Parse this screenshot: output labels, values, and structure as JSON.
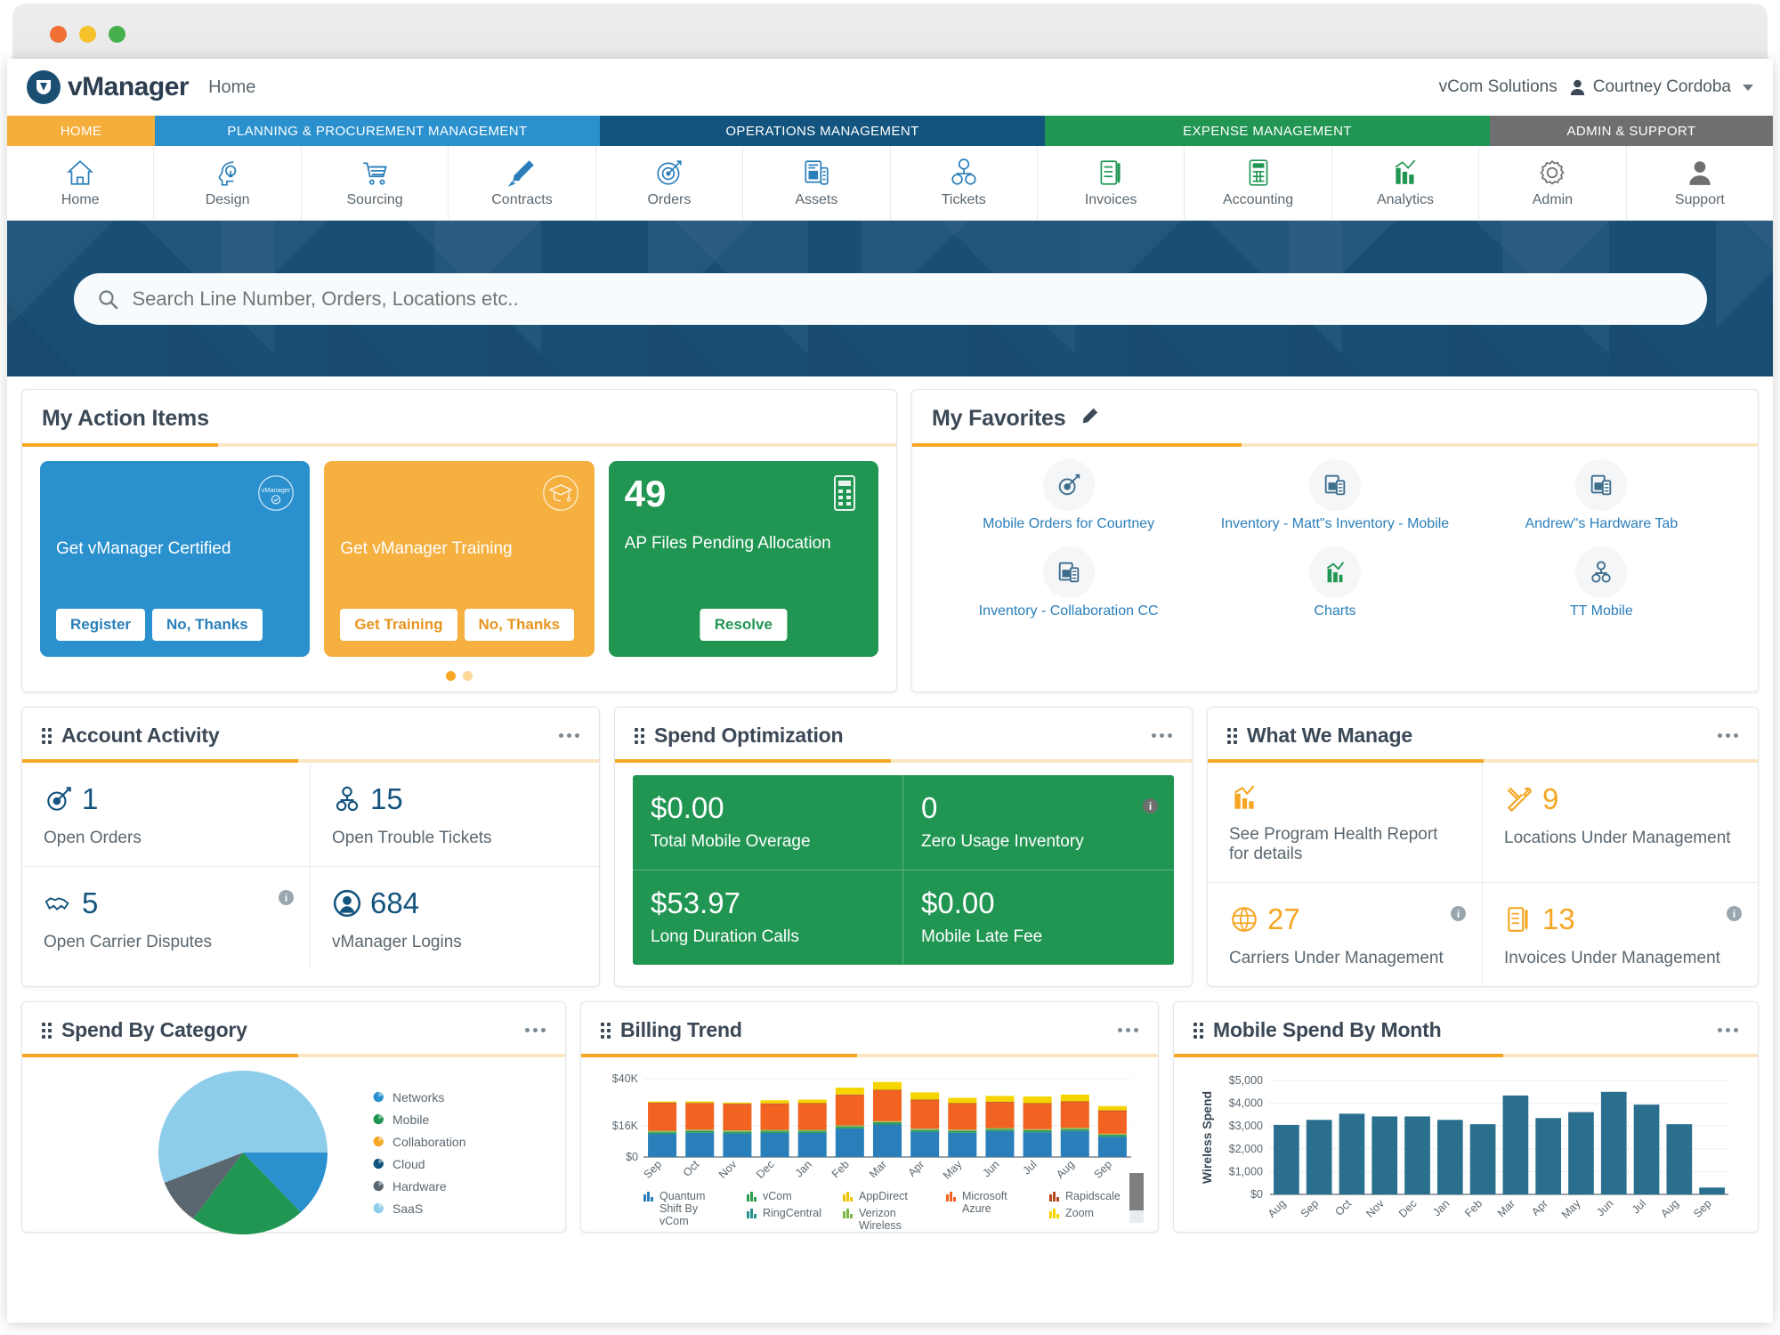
{
  "window": {
    "dots": [
      "close",
      "minimize",
      "maximize"
    ]
  },
  "brand": {
    "logo_text": "vManager",
    "breadcrumb": "Home",
    "company": "vCom Solutions",
    "user": "Courtney Cordoba"
  },
  "segments": [
    {
      "label": "HOME",
      "color": "#f5ae3c"
    },
    {
      "label": "PLANNING & PROCUREMENT MANAGEMENT",
      "color": "#2a90ce"
    },
    {
      "label": "OPERATIONS MANAGEMENT",
      "color": "#13547e"
    },
    {
      "label": "EXPENSE MANAGEMENT",
      "color": "#219653"
    },
    {
      "label": "ADMIN & SUPPORT",
      "color": "#6f6f6f"
    }
  ],
  "nav_icons": [
    {
      "label": "Home",
      "icon": "home-icon"
    },
    {
      "label": "Design",
      "icon": "design-head-bulb-icon"
    },
    {
      "label": "Sourcing",
      "icon": "shopping-cart-icon"
    },
    {
      "label": "Contracts",
      "icon": "pen-signature-icon"
    },
    {
      "label": "Orders",
      "icon": "target-arrow-icon"
    },
    {
      "label": "Assets",
      "icon": "devices-icon"
    },
    {
      "label": "Tickets",
      "icon": "tickets-nodes-icon"
    },
    {
      "label": "Invoices",
      "icon": "invoice-checklist-icon"
    },
    {
      "label": "Accounting",
      "icon": "calculator-icon"
    },
    {
      "label": "Analytics",
      "icon": "bar-chart-icon"
    },
    {
      "label": "Admin",
      "icon": "gear-icon"
    },
    {
      "label": "Support",
      "icon": "person-icon"
    }
  ],
  "search": {
    "placeholder": "Search Line Number, Orders, Locations etc..",
    "value": ""
  },
  "action_items": {
    "title": "My Action Items",
    "cards": [
      {
        "color": "blue",
        "value": "",
        "label": "Get vManager Certified",
        "icon": "vmanager-certified-badge-icon",
        "buttons": [
          "Register",
          "No, Thanks"
        ]
      },
      {
        "color": "orange",
        "value": "",
        "label": "Get vManager Training",
        "icon": "graduation-cap-icon",
        "buttons": [
          "Get Training",
          "No, Thanks"
        ]
      },
      {
        "color": "green",
        "value": "49",
        "label": "AP Files Pending Allocation",
        "icon": "calculator-icon",
        "buttons": [
          "Resolve"
        ]
      }
    ],
    "pager": {
      "count": 2,
      "active": 0
    }
  },
  "favorites": {
    "title": "My Favorites",
    "edit_icon": "pencil-icon",
    "items": [
      {
        "label": "Mobile Orders for Courtney",
        "icon": "target-arrow-icon",
        "color": "blue"
      },
      {
        "label": "Inventory - Matt\"s Inventory - Mobile",
        "icon": "devices-icon",
        "color": "blue"
      },
      {
        "label": "Andrew\"s Hardware Tab",
        "icon": "devices-icon",
        "color": "blue"
      },
      {
        "label": "Inventory - Collaboration CC",
        "icon": "devices-icon",
        "color": "blue"
      },
      {
        "label": "Charts",
        "icon": "bar-chart-icon",
        "color": "green"
      },
      {
        "label": "TT Mobile",
        "icon": "tickets-nodes-icon",
        "color": "blue"
      }
    ]
  },
  "account_activity": {
    "title": "Account Activity",
    "menu_icon": "ellipsis-icon",
    "stats": [
      {
        "value": "1",
        "caption": "Open Orders",
        "icon": "target-arrow-icon",
        "info": false
      },
      {
        "value": "15",
        "caption": "Open Trouble Tickets",
        "icon": "tickets-nodes-icon",
        "info": false
      },
      {
        "value": "5",
        "caption": "Open Carrier Disputes",
        "icon": "handshake-icon",
        "info": true
      },
      {
        "value": "684",
        "caption": "vManager Logins",
        "icon": "person-circle-icon",
        "info": false
      }
    ]
  },
  "spend_optimization": {
    "title": "Spend Optimization",
    "menu_icon": "ellipsis-icon",
    "tiles": [
      {
        "value": "$0.00",
        "caption": "Total Mobile Overage",
        "info": false
      },
      {
        "value": "0",
        "caption": "Zero Usage Inventory",
        "info": true
      },
      {
        "value": "$53.97",
        "caption": "Long Duration Calls",
        "info": false
      },
      {
        "value": "$0.00",
        "caption": "Mobile Late Fee",
        "info": false
      }
    ]
  },
  "what_we_manage": {
    "title": "What We Manage",
    "menu_icon": "ellipsis-icon",
    "stats": [
      {
        "value": "",
        "caption": "See Program Health Report for details",
        "icon": "bar-chart-icon",
        "info": false
      },
      {
        "value": "9",
        "caption": "Locations Under Management",
        "icon": "tools-icon",
        "info": false
      },
      {
        "value": "27",
        "caption": "Carriers Under Management",
        "icon": "globe-icon",
        "info": true
      },
      {
        "value": "13",
        "caption": "Invoices Under Management",
        "icon": "invoice-checklist-icon",
        "info": true
      }
    ]
  },
  "spend_by_category": {
    "title": "Spend By Category",
    "menu_icon": "ellipsis-icon"
  },
  "billing_trend": {
    "title": "Billing Trend",
    "menu_icon": "ellipsis-icon"
  },
  "mobile_spend": {
    "title": "Mobile Spend By Month",
    "menu_icon": "ellipsis-icon"
  },
  "chart_data": [
    {
      "type": "pie",
      "title": "Spend By Category",
      "legend_position": "right",
      "labels": [
        "Networks",
        "Mobile",
        "Collaboration",
        "Cloud",
        "Hardware",
        "SaaS"
      ],
      "values": [
        13,
        22,
        0,
        0,
        9,
        56
      ],
      "colors": [
        "#2a90ce",
        "#219653",
        "#f5a623",
        "#13547e",
        "#5b6770",
        "#8ecdea"
      ]
    },
    {
      "type": "bar",
      "stacked": true,
      "title": "Billing Trend",
      "xlabel": "",
      "ylabel": "",
      "ylim": [
        0,
        40000
      ],
      "yticks": [
        "$0",
        "$16K",
        "$40K"
      ],
      "ytick_values": [
        0,
        16000,
        40000
      ],
      "grid": true,
      "categories": [
        "Sep",
        "Oct",
        "Nov",
        "Dec",
        "Jan",
        "Feb",
        "Mar",
        "Apr",
        "May",
        "Jun",
        "Jul",
        "Aug",
        "Sep"
      ],
      "series": [
        {
          "name": "Quantum Shift By vCom",
          "color": "#2a7fba",
          "values": [
            11800,
            12400,
            12000,
            12300,
            12300,
            14600,
            16600,
            12900,
            12400,
            13200,
            12600,
            13300,
            10400
          ]
        },
        {
          "name": "vCom",
          "color": "#2e9e4e",
          "values": [
            800,
            800,
            800,
            800,
            800,
            800,
            900,
            800,
            800,
            800,
            800,
            800,
            700
          ]
        },
        {
          "name": "RingCentral",
          "color": "#2a8f8f",
          "values": [
            300,
            300,
            300,
            300,
            300,
            300,
            300,
            300,
            300,
            300,
            300,
            300,
            300
          ]
        },
        {
          "name": "AppDirect",
          "color": "#f2c200",
          "values": [
            200,
            200,
            200,
            200,
            200,
            200,
            200,
            200,
            200,
            200,
            200,
            200,
            200
          ]
        },
        {
          "name": "Verizon Wireless",
          "color": "#7ab648",
          "values": [
            300,
            300,
            300,
            300,
            300,
            300,
            300,
            300,
            300,
            300,
            300,
            300,
            300
          ]
        },
        {
          "name": "Microsoft Azure",
          "color": "#f26322",
          "values": [
            14000,
            13200,
            13200,
            13100,
            13200,
            15300,
            15600,
            14400,
            13100,
            13000,
            12900,
            13100,
            11500
          ]
        },
        {
          "name": "Rapidscale",
          "color": "#b5461c",
          "values": [
            400,
            400,
            400,
            400,
            400,
            400,
            400,
            400,
            400,
            400,
            400,
            400,
            400
          ]
        },
        {
          "name": "Zoom",
          "color": "#f5d400",
          "values": [
            600,
            800,
            600,
            1600,
            1800,
            3500,
            4000,
            3700,
            2700,
            3000,
            3400,
            3500,
            2200
          ]
        }
      ]
    },
    {
      "type": "bar",
      "title": "Mobile Spend By Month",
      "xlabel": "",
      "ylabel": "Wireless Spend",
      "ylim": [
        0,
        5000
      ],
      "yticks": [
        "$0",
        "$1,000",
        "$2,000",
        "$3,000",
        "$4,000",
        "$5,000"
      ],
      "ytick_values": [
        0,
        1000,
        2000,
        3000,
        4000,
        5000
      ],
      "grid": true,
      "bar_color": "#2a6f8e",
      "categories": [
        "Aug",
        "Sep",
        "Oct",
        "Nov",
        "Dec",
        "Jan",
        "Feb",
        "Mar",
        "Apr",
        "May",
        "Jun",
        "Jul",
        "Aug",
        "Sep"
      ],
      "values": [
        3050,
        3270,
        3540,
        3420,
        3420,
        3270,
        3080,
        4340,
        3350,
        3610,
        4500,
        3940,
        3080,
        300
      ]
    }
  ]
}
